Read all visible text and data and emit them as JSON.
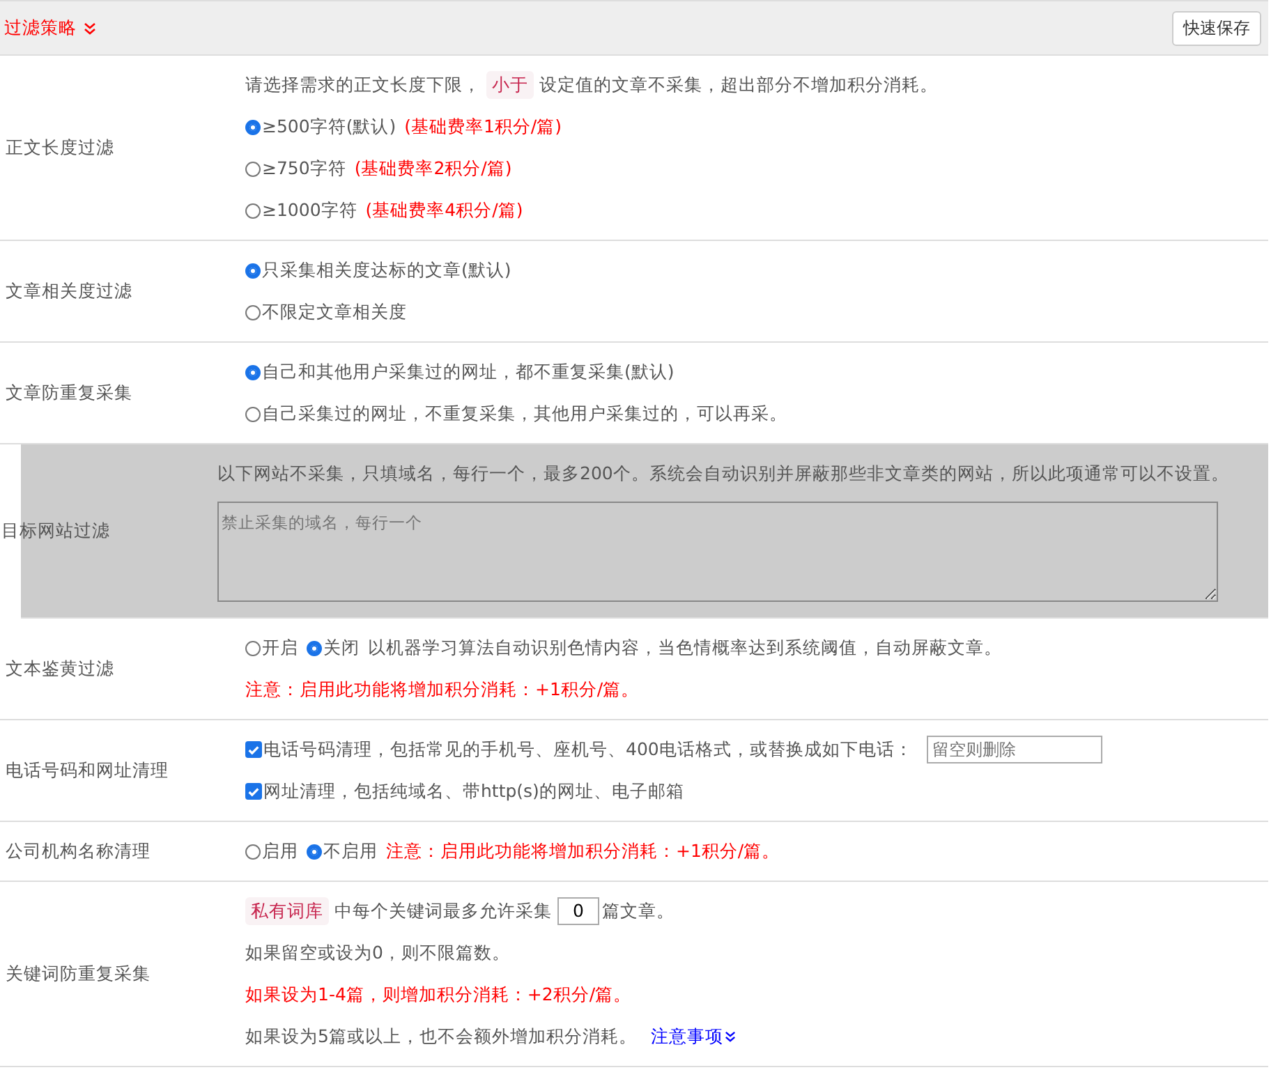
{
  "header": {
    "title": "过滤策略",
    "button": "快速保存"
  },
  "rows": [
    {
      "label": "正文长度过滤",
      "highlighted": false,
      "lines": [
        [
          {
            "kind": "text",
            "text": "请选择需求的正文长度下限，",
            "warning": false
          },
          {
            "kind": "tag",
            "text": "小于"
          },
          {
            "kind": "text",
            "text": "设定值的文章不采集，超出部分不增加积分消耗。",
            "warning": false
          }
        ],
        [
          {
            "kind": "radio",
            "label": "≥500字符(默认)",
            "selected": true
          },
          {
            "kind": "text",
            "text": "(基础费率1积分/篇)",
            "warning": true
          }
        ],
        [
          {
            "kind": "radio",
            "label": "≥750字符",
            "selected": false
          },
          {
            "kind": "text",
            "text": "(基础费率2积分/篇)",
            "warning": true
          }
        ],
        [
          {
            "kind": "radio",
            "label": "≥1000字符",
            "selected": false
          },
          {
            "kind": "text",
            "text": "(基础费率4积分/篇)",
            "warning": true
          }
        ]
      ]
    },
    {
      "label": "文章相关度过滤",
      "highlighted": false,
      "lines": [
        [
          {
            "kind": "radio",
            "label": "只采集相关度达标的文章(默认)",
            "selected": true
          }
        ],
        [
          {
            "kind": "radio",
            "label": "不限定文章相关度",
            "selected": false
          }
        ]
      ]
    },
    {
      "label": "文章防重复采集",
      "highlighted": false,
      "lines": [
        [
          {
            "kind": "radio",
            "label": "自己和其他用户采集过的网址，都不重复采集(默认)",
            "selected": true
          }
        ],
        [
          {
            "kind": "radio",
            "label": "自己采集过的网址，不重复采集，其他用户采集过的，可以再采。",
            "selected": false
          }
        ]
      ]
    },
    {
      "label": "目标网站过滤",
      "highlighted": true,
      "lines": [
        [
          {
            "kind": "text",
            "text": "以下网站不采集，只填域名，每行一个，最多200个。系统会自动识别并屏蔽那些非文章类的网站，所以此项通常可以不设置。",
            "warning": false
          }
        ],
        [
          {
            "kind": "textarea",
            "placeholder": "禁止采集的域名，每行一个"
          }
        ]
      ]
    },
    {
      "label": "文本鉴黄过滤",
      "highlighted": false,
      "lines": [
        [
          {
            "kind": "radio",
            "label": "开启",
            "selected": false
          },
          {
            "kind": "radio",
            "label": "关闭",
            "selected": true
          },
          {
            "kind": "text",
            "text": "以机器学习算法自动识别色情内容，当色情概率达到系统阈值，自动屏蔽文章。",
            "warning": false
          }
        ],
        [
          {
            "kind": "text",
            "text": "注意：启用此功能将增加积分消耗：+1积分/篇。",
            "warning": true
          }
        ]
      ]
    },
    {
      "label": "电话号码和网址清理",
      "highlighted": false,
      "lines": [
        [
          {
            "kind": "check",
            "label": "电话号码清理，包括常见的手机号、座机号、400电话格式，或替换成如下电话：",
            "checked": true
          },
          {
            "kind": "input",
            "placeholder": "留空则删除"
          }
        ],
        [
          {
            "kind": "check",
            "label": "网址清理，包括纯域名、带http(s)的网址、电子邮箱",
            "checked": true
          }
        ]
      ]
    },
    {
      "label": "公司机构名称清理",
      "highlighted": false,
      "lines": [
        [
          {
            "kind": "radio",
            "label": "启用",
            "selected": false
          },
          {
            "kind": "radio",
            "label": "不启用",
            "selected": true
          },
          {
            "kind": "text",
            "text": "注意：启用此功能将增加积分消耗：+1积分/篇。",
            "warning": true
          }
        ]
      ]
    },
    {
      "label": "关键词防重复采集",
      "highlighted": false,
      "lines": [
        [
          {
            "kind": "tag",
            "text": "私有词库"
          },
          {
            "kind": "text",
            "text": "中每个关键词最多允许采集",
            "warning": false
          },
          {
            "kind": "number",
            "value": "0"
          },
          {
            "kind": "text",
            "text": "篇文章。",
            "warning": false
          }
        ],
        [
          {
            "kind": "text",
            "text": "如果留空或设为0，则不限篇数。",
            "warning": false
          }
        ],
        [
          {
            "kind": "text",
            "text": "如果设为1-4篇，则增加积分消耗：+2积分/篇。",
            "warning": true
          }
        ],
        [
          {
            "kind": "text",
            "text": "如果设为5篇或以上，也不会额外增加积分消耗。",
            "warning": false
          },
          {
            "kind": "link",
            "text": "注意事项"
          }
        ]
      ]
    }
  ]
}
